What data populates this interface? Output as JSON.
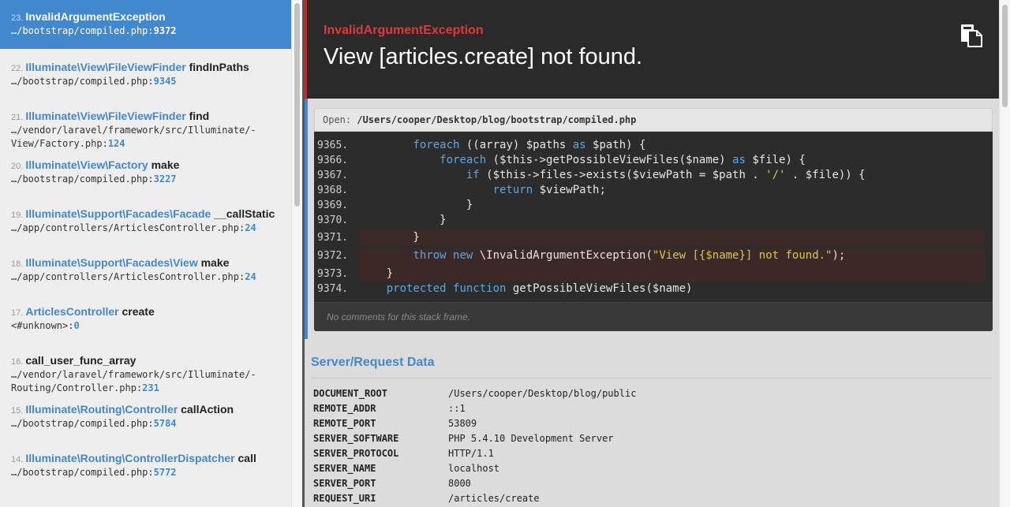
{
  "stack_frames": [
    {
      "num": "23.",
      "class": "InvalidArgumentException",
      "func": "",
      "file": "…/bootstrap/compiled.php:",
      "line": "9372",
      "active": true
    },
    {
      "num": "22.",
      "class": "Illuminate\\View\\FileViewFinder",
      "func": " findInPaths",
      "file": "…/bootstrap/compiled.php:",
      "line": "9345",
      "active": false
    },
    {
      "num": "21.",
      "class": "Illuminate\\View\\FileViewFinder",
      "func": " find",
      "file": "…/vendor/laravel/framework/src/Illuminate/-\nView/Factory.php:",
      "line": "124",
      "active": false
    },
    {
      "num": "20.",
      "class": "Illuminate\\View\\Factory",
      "func": " make",
      "file": "…/bootstrap/compiled.php:",
      "line": "3227",
      "active": false
    },
    {
      "num": "19.",
      "class": "Illuminate\\Support\\Facades\\Facade",
      "func": " __callStatic",
      "file": "…/app/controllers/ArticlesController.php:",
      "line": "24",
      "active": false
    },
    {
      "num": "18.",
      "class": "Illuminate\\Support\\Facades\\View",
      "func": " make",
      "file": "…/app/controllers/ArticlesController.php:",
      "line": "24",
      "active": false
    },
    {
      "num": "17.",
      "class": "ArticlesController",
      "func": " create",
      "file": "<#unknown>:",
      "line": "0",
      "active": false
    },
    {
      "num": "16.",
      "class": "",
      "func": "call_user_func_array",
      "file": "…/vendor/laravel/framework/src/Illuminate/-\nRouting/Controller.php:",
      "line": "231",
      "active": false
    },
    {
      "num": "15.",
      "class": "Illuminate\\Routing\\Controller",
      "func": " callAction",
      "file": "…/bootstrap/compiled.php:",
      "line": "5784",
      "active": false
    },
    {
      "num": "14.",
      "class": "Illuminate\\Routing\\ControllerDispatcher",
      "func": " call",
      "file": "…/bootstrap/compiled.php:",
      "line": "5772",
      "active": false
    }
  ],
  "header": {
    "exception_class": "InvalidArgumentException",
    "message": "View [articles.create] not found.",
    "copy_icon": "clipboard-icon"
  },
  "code": {
    "open_label": "Open:",
    "open_path": "/Users/cooper/Desktop/blog/bootstrap/compiled.php",
    "lines": [
      {
        "n": "9365.",
        "parts": [
          [
            "",
            "        "
          ],
          [
            "kw",
            "foreach"
          ],
          [
            "",
            " ((array) $paths "
          ],
          [
            "kw",
            "as"
          ],
          [
            "",
            " $path) {"
          ]
        ],
        "hl": false
      },
      {
        "n": "9366.",
        "parts": [
          [
            "",
            "            "
          ],
          [
            "kw",
            "foreach"
          ],
          [
            "",
            " ($this->getPossibleViewFiles($name) "
          ],
          [
            "kw",
            "as"
          ],
          [
            "",
            " $file) {"
          ]
        ],
        "hl": false
      },
      {
        "n": "9367.",
        "parts": [
          [
            "",
            "                "
          ],
          [
            "kw",
            "if"
          ],
          [
            "",
            " ($this->files->exists($viewPath = $path . "
          ],
          [
            "str",
            "'/'"
          ],
          [
            "",
            " . $file)) {"
          ]
        ],
        "hl": false
      },
      {
        "n": "9368.",
        "parts": [
          [
            "",
            "                    "
          ],
          [
            "kw",
            "return"
          ],
          [
            "",
            " $viewPath;"
          ]
        ],
        "hl": false
      },
      {
        "n": "9369.",
        "parts": [
          [
            "",
            "                }"
          ]
        ],
        "hl": false
      },
      {
        "n": "9370.",
        "parts": [
          [
            "",
            "            }"
          ]
        ],
        "hl": false
      },
      {
        "n": "9371.",
        "parts": [
          [
            "",
            "        }"
          ]
        ],
        "hl": true
      },
      {
        "n": "9372.",
        "parts": [
          [
            "",
            "        "
          ],
          [
            "kw",
            "throw"
          ],
          [
            "",
            " "
          ],
          [
            "kw",
            "new"
          ],
          [
            "",
            " \\InvalidArgumentException("
          ],
          [
            "str",
            "\"View [{$name}] not found.\""
          ],
          [
            "",
            ");"
          ]
        ],
        "hl": true
      },
      {
        "n": "9373.",
        "parts": [
          [
            "",
            "    }"
          ]
        ],
        "hl": true
      },
      {
        "n": "9374.",
        "parts": [
          [
            "",
            "    "
          ],
          [
            "kw",
            "protected"
          ],
          [
            "",
            " "
          ],
          [
            "kw",
            "function"
          ],
          [
            "",
            " getPossibleViewFiles($name)"
          ]
        ],
        "hl": false
      }
    ],
    "comments_text": "No comments for this stack frame."
  },
  "server": {
    "title": "Server/Request Data",
    "rows": [
      {
        "key": "DOCUMENT_ROOT",
        "value": "/Users/cooper/Desktop/blog/public"
      },
      {
        "key": "REMOTE_ADDR",
        "value": "::1"
      },
      {
        "key": "REMOTE_PORT",
        "value": "53809"
      },
      {
        "key": "SERVER_SOFTWARE",
        "value": "PHP 5.4.10 Development Server"
      },
      {
        "key": "SERVER_PROTOCOL",
        "value": "HTTP/1.1"
      },
      {
        "key": "SERVER_NAME",
        "value": "localhost"
      },
      {
        "key": "SERVER_PORT",
        "value": "8000"
      },
      {
        "key": "REQUEST_URI",
        "value": "/articles/create"
      }
    ]
  },
  "colors": {
    "accent": "#4288ce",
    "error": "#e2383c",
    "header_bg": "#2a2a2a"
  }
}
